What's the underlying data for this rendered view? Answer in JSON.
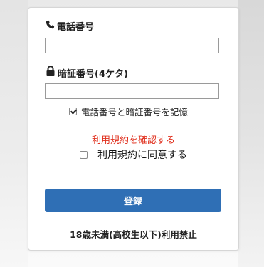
{
  "form": {
    "phone_label": "電話番号",
    "phone_value": "",
    "pin_label": "暗証番号(4ケタ)",
    "pin_value": "",
    "remember_label": "電話番号と暗証番号を記憶",
    "remember_checked": true,
    "terms_link": "利用規約を確認する",
    "agree_label": "利用規約に同意する",
    "agree_checked": false,
    "register_label": "登録",
    "age_notice": "18歳未満(高校生以下)利用禁止"
  },
  "icons": {
    "phone": "phone-icon",
    "pin": "lock-icon"
  },
  "colors": {
    "button": "#2f6fb5",
    "link": "#e0301e"
  }
}
